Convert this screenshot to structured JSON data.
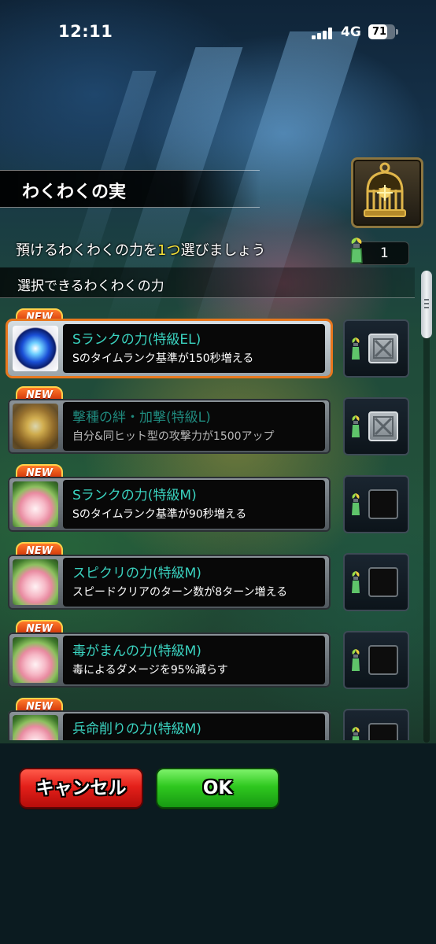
{
  "status_bar": {
    "time": "12:11",
    "network": "4G",
    "battery": "71",
    "battery_level": 0.71
  },
  "header": {
    "title": "わくわくの実"
  },
  "instruction": {
    "prefix": "預けるわくわくの力を",
    "highlight": "1つ",
    "suffix": "選びましょう"
  },
  "counter": {
    "value": "1"
  },
  "list": {
    "heading": "選択できるわくわくの力",
    "items": [
      {
        "badge": "NEW",
        "name": "Sランクの力(特級EL)",
        "desc": "Sのタイムランク基準が150秒増える",
        "selected": true,
        "dimmed": false,
        "checkbox": "crossed",
        "icon": "blue-orb-icon"
      },
      {
        "badge": "NEW",
        "name": "撃種の絆・加撃(特級L)",
        "desc": "自分&同ヒット型の攻撃力が1500アップ",
        "selected": false,
        "dimmed": true,
        "checkbox": "crossed",
        "icon": "gold-orb-icon"
      },
      {
        "badge": "NEW",
        "name": "Sランクの力(特級M)",
        "desc": "Sのタイムランク基準が90秒増える",
        "selected": false,
        "dimmed": false,
        "checkbox": "empty",
        "icon": "lotus-fruit-icon"
      },
      {
        "badge": "NEW",
        "name": "スピクリの力(特級M)",
        "desc": "スピードクリアのターン数が8ターン増える",
        "selected": false,
        "dimmed": false,
        "checkbox": "empty",
        "icon": "lotus-fruit-icon"
      },
      {
        "badge": "NEW",
        "name": "毒がまんの力(特級M)",
        "desc": "毒によるダメージを95%減らす",
        "selected": false,
        "dimmed": false,
        "checkbox": "empty",
        "icon": "lotus-fruit-icon"
      },
      {
        "badge": "NEW",
        "name": "兵命削りの力(特級M)",
        "desc": "",
        "selected": false,
        "dimmed": false,
        "checkbox": "empty",
        "icon": "lotus-fruit-icon"
      }
    ]
  },
  "buttons": {
    "cancel": "キャンセル",
    "ok": "OK"
  },
  "colors": {
    "accent": "#e8781e",
    "item_name": "#3ad3c0",
    "highlight": "#f5e23a",
    "cancel": "#e4201a",
    "ok": "#2fc81f"
  }
}
